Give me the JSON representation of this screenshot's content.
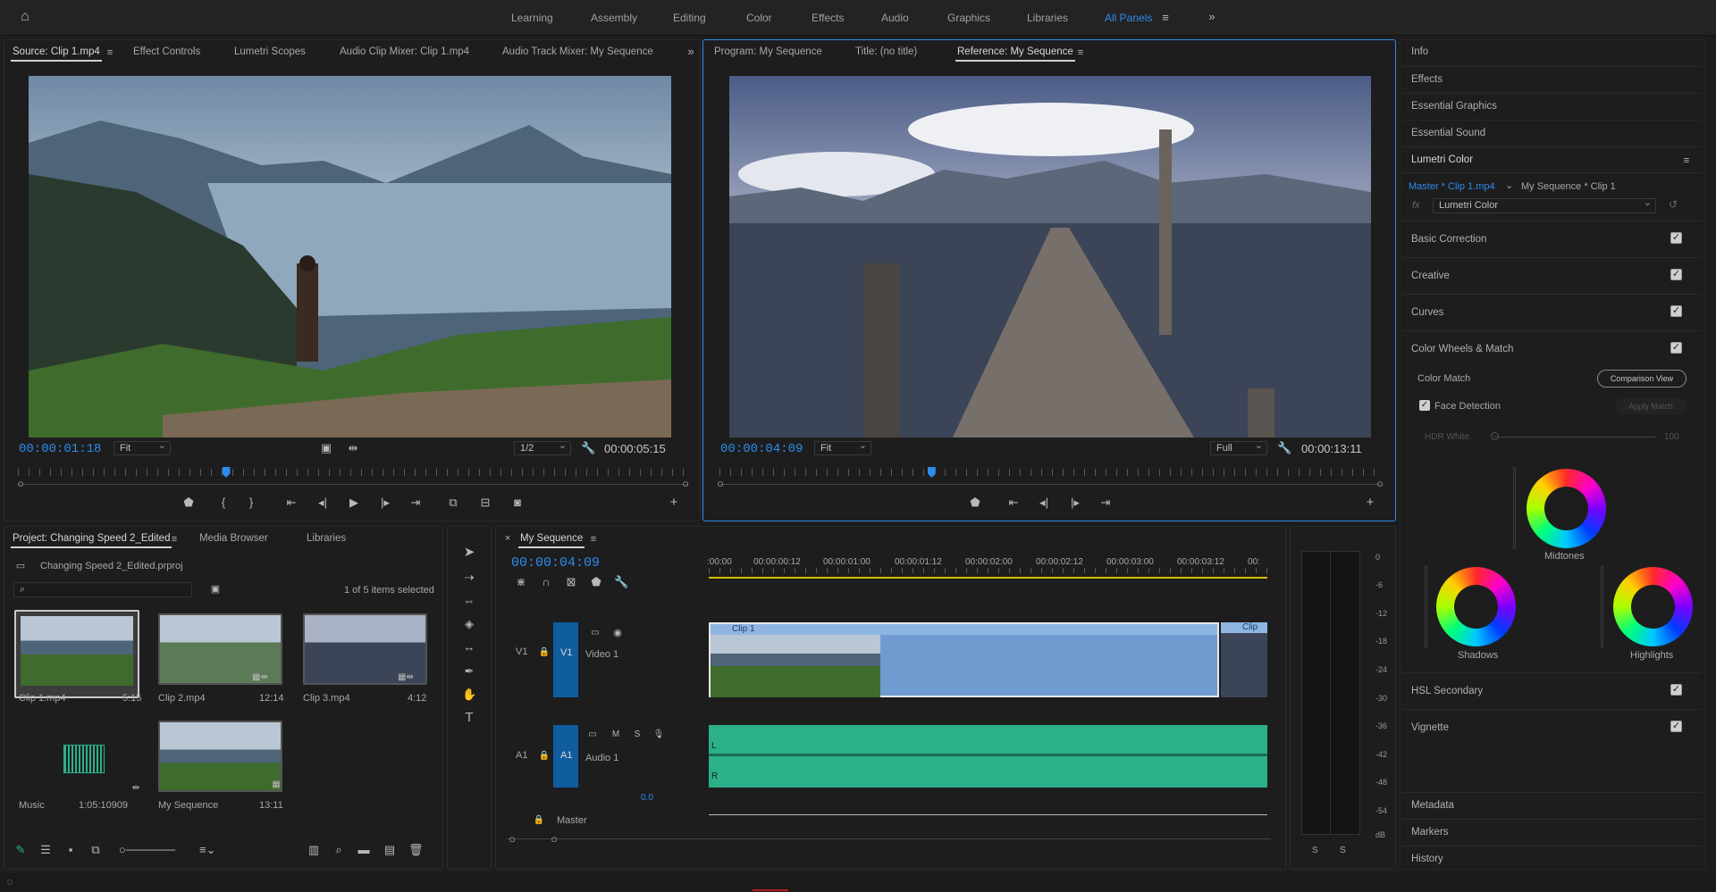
{
  "workspaces": {
    "items": [
      "Learning",
      "Assembly",
      "Editing",
      "Color",
      "Effects",
      "Audio",
      "Graphics",
      "Libraries",
      "All Panels"
    ],
    "active": "All Panels"
  },
  "source_panel": {
    "tabs": [
      "Source: Clip 1.mp4",
      "Effect Controls",
      "Lumetri Scopes",
      "Audio Clip Mixer: Clip 1.mp4",
      "Audio Track Mixer: My Sequence"
    ],
    "timecode": "00:00:01:18",
    "fit": "Fit",
    "resolution": "1/2",
    "duration": "00:00:05:15",
    "playhead_fraction": 0.31
  },
  "program_panel": {
    "tabs": [
      "Program: My Sequence",
      "Title: (no title)",
      "Reference: My Sequence"
    ],
    "timecode": "00:00:04:09",
    "fit": "Fit",
    "resolution": "Full",
    "duration": "00:00:13:11",
    "playhead_fraction": 0.32
  },
  "right_panel": {
    "sections": [
      "Info",
      "Effects",
      "Essential Graphics",
      "Essential Sound"
    ],
    "lumetri_title": "Lumetri Color",
    "master_clip": "Master * Clip 1.mp4",
    "seq_clip": "My Sequence * Clip 1",
    "fx_label": "fx",
    "effect": "Lumetri Color",
    "groups": [
      "Basic Correction",
      "Creative",
      "Curves",
      "Color Wheels & Match"
    ],
    "color_match": "Color Match",
    "comparison_view": "Comparison View",
    "face_detection": "Face Detection",
    "apply_match": "Apply Match",
    "hdr_white": "HDR White",
    "hdr_value": "100",
    "wheels": [
      "Midtones",
      "Shadows",
      "Highlights"
    ],
    "lower_groups": [
      "HSL Secondary",
      "Vignette"
    ],
    "bottom_sections": [
      "Metadata",
      "Markers",
      "History"
    ]
  },
  "project": {
    "tabs": [
      "Project: Changing Speed 2_Edited",
      "Media Browser",
      "Libraries"
    ],
    "file": "Changing Speed 2_Edited.prproj",
    "selection": "1 of 5 items selected",
    "items": [
      {
        "name": "Clip 1.mp4",
        "dur": "5:15"
      },
      {
        "name": "Clip 2.mp4",
        "dur": "12:14"
      },
      {
        "name": "Clip 3.mp4",
        "dur": "4:12"
      },
      {
        "name": "Music",
        "dur": "1:05:10909"
      },
      {
        "name": "My Sequence",
        "dur": "13:11"
      }
    ]
  },
  "timeline": {
    "title": "My Sequence",
    "timecode": "00:00:04:09",
    "ruler": [
      ":00:00",
      "00:00:00:12",
      "00:00:01:00",
      "00:00:01:12",
      "00:00:02:00",
      "00:00:02:12",
      "00:00:03:00",
      "00:00:03:12",
      "00:"
    ],
    "video_track": {
      "id": "V1",
      "name": "Video 1",
      "clip": "Clip 1",
      "clip2": "Clip"
    },
    "audio_track": {
      "id": "A1",
      "name": "Audio 1"
    },
    "master": {
      "label": "Master",
      "value": "0.0"
    },
    "channels": [
      "L",
      "R"
    ]
  },
  "meter": {
    "ticks": [
      "0",
      "-6",
      "-12",
      "-18",
      "-24",
      "-30",
      "-36",
      "-42",
      "-48",
      "-54",
      "dB"
    ],
    "solo": [
      "S",
      "S"
    ]
  },
  "colors": {
    "accent": "#2d8ceb",
    "clip_blue": "#6f9bd1",
    "audio_green": "#2bb08a"
  }
}
